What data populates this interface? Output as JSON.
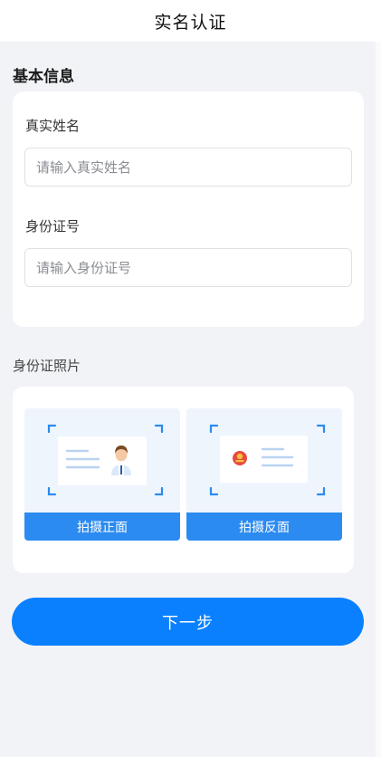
{
  "header": {
    "title": "实名认证"
  },
  "basic_info": {
    "section_title": "基本信息",
    "name": {
      "label": "真实姓名",
      "value": "",
      "placeholder": "请输入真实姓名"
    },
    "id_number": {
      "label": "身份证号",
      "value": "",
      "placeholder": "请输入身份证号"
    }
  },
  "id_photos": {
    "section_title": "身份证照片",
    "front": {
      "button_label": "拍摄正面",
      "icon": "id-card-front-icon"
    },
    "back": {
      "button_label": "拍摄反面",
      "icon": "id-card-back-emblem-icon"
    }
  },
  "footer": {
    "next_button_label": "下一步"
  },
  "colors": {
    "accent": "#0a80ff",
    "tile_button": "#2b8bf0",
    "tile_background": "#eef5fd",
    "page_background": "#f2f3f7"
  }
}
